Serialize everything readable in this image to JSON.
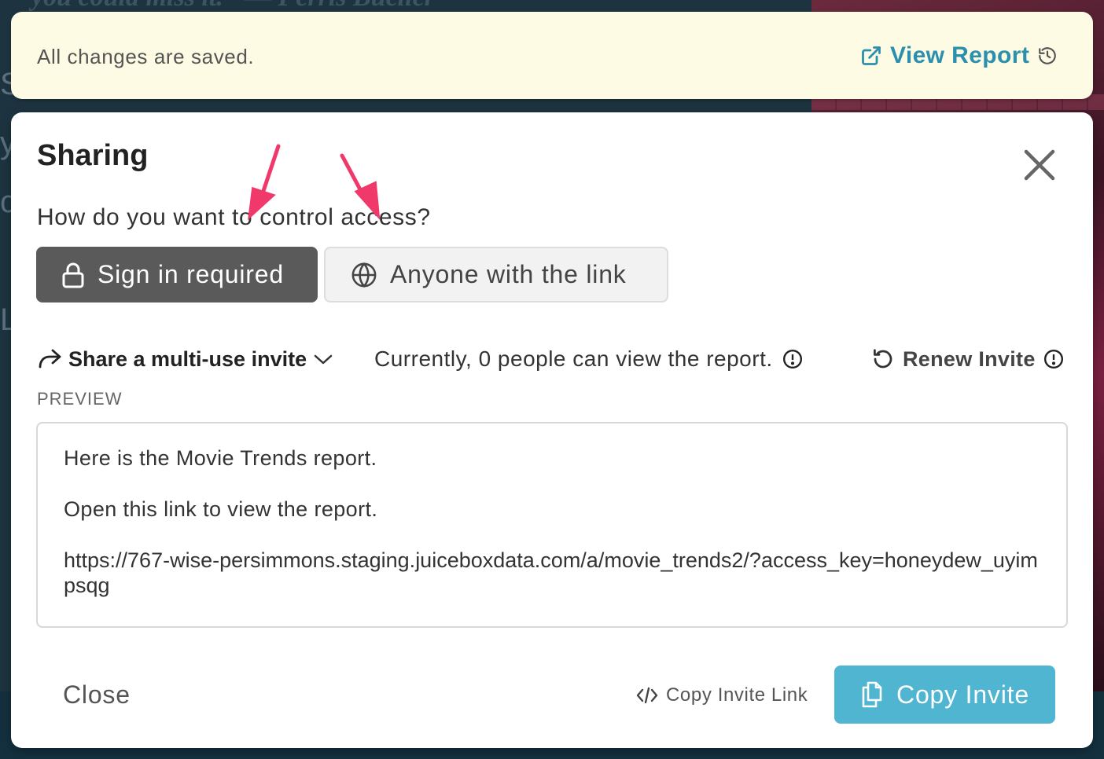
{
  "background": {
    "top_text": "you could miss it.\" — Ferris Bueller"
  },
  "banner": {
    "status_text": "All changes are saved.",
    "view_report_label": "View Report"
  },
  "modal": {
    "title": "Sharing",
    "question": "How do you want to control access?",
    "access_options": [
      {
        "label": "Sign in required",
        "icon": "lock-icon",
        "selected": true
      },
      {
        "label": "Anyone with the link",
        "icon": "globe-icon",
        "selected": false
      }
    ],
    "share_mode_label": "Share a multi-use invite",
    "viewers_text": "Currently, 0 people can view the report.",
    "renew_label": "Renew Invite",
    "preview_label": "PREVIEW",
    "preview": {
      "line1": "Here is the Movie Trends report.",
      "line2": "Open this link to view the report.",
      "url": "https://767-wise-persimmons.staging.juiceboxdata.com/a/movie_trends2/?access_key=honeydew_uyimpsqg"
    },
    "close_label": "Close",
    "copy_link_label": "Copy Invite Link",
    "copy_invite_label": "Copy Invite"
  },
  "colors": {
    "banner_bg": "#fdfbe3",
    "accent_link": "#2b8fae",
    "selected_option_bg": "#5a5a5a",
    "primary_button": "#4fb5d1",
    "annotation_arrow": "#f0386b"
  }
}
